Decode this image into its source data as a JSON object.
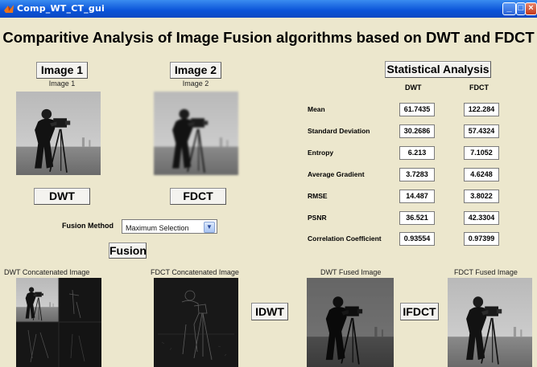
{
  "window": {
    "title": "Comp_WT_CT_gui"
  },
  "main_title": "Comparitive Analysis of Image Fusion algorithms based on DWT and FDCT",
  "image1": {
    "button": "Image 1",
    "caption": "Image 1"
  },
  "image2": {
    "button": "Image 2",
    "caption": "Image 2"
  },
  "buttons": {
    "dwt": "DWT",
    "fdct": "FDCT",
    "fusion": "Fusion",
    "idwt": "IDWT",
    "ifdct": "IFDCT",
    "stats": "Statistical Analysis"
  },
  "fusion_method": {
    "label": "Fusion Method",
    "selected": "Maximum Selection"
  },
  "stats": {
    "col_dwt": "DWT",
    "col_fdct": "FDCT",
    "rows": [
      {
        "label": "Mean",
        "dwt": "61.7435",
        "fdct": "122.284"
      },
      {
        "label": "Standard Deviation",
        "dwt": "30.2686",
        "fdct": "57.4324"
      },
      {
        "label": "Entropy",
        "dwt": "6.213",
        "fdct": "7.1052"
      },
      {
        "label": "Average Gradient",
        "dwt": "3.7283",
        "fdct": "4.6248"
      },
      {
        "label": "RMSE",
        "dwt": "14.487",
        "fdct": "3.8022"
      },
      {
        "label": "PSNR",
        "dwt": "36.521",
        "fdct": "42.3304"
      },
      {
        "label": "Correlation Coefficient",
        "dwt": "0.93554",
        "fdct": "0.97399"
      }
    ]
  },
  "captions": {
    "dwt_concat": "DWT Concatenated Image",
    "fdct_concat": "FDCT Concatenated Image",
    "dwt_fused": "DWT Fused Image",
    "fdct_fused": "FDCT Fused Image"
  },
  "icons": {
    "app": "matlab-icon",
    "minimize": "minimize-icon",
    "maximize": "maximize-icon",
    "close": "close-icon"
  }
}
